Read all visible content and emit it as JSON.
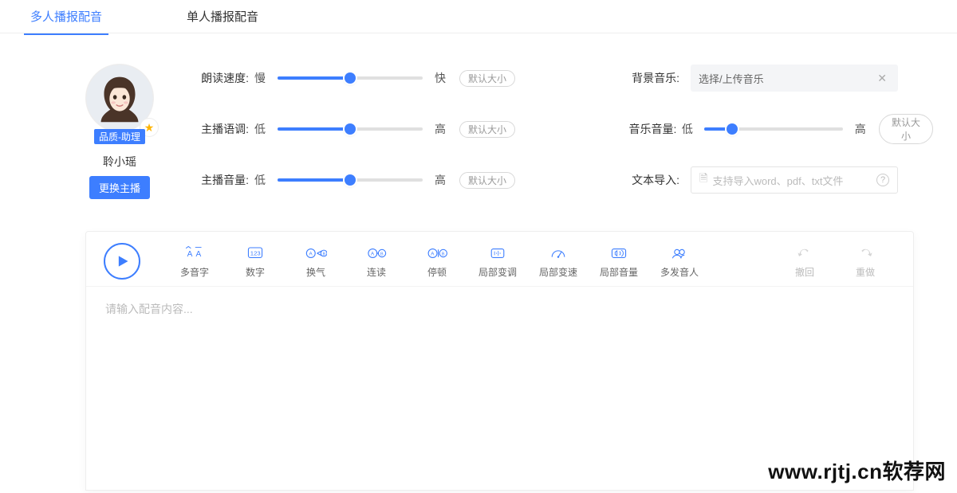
{
  "tabs": {
    "multi": "多人播报配音",
    "single": "单人播报配音"
  },
  "anchor": {
    "quality_tag": "品质-助理",
    "name": "聆小瑶",
    "swap_btn": "更换主播"
  },
  "sliders": {
    "default_size": "默认大小",
    "speed": {
      "label": "朗读速度:",
      "low": "慢",
      "high": "快",
      "pct": 50
    },
    "tone": {
      "label": "主播语调:",
      "low": "低",
      "high": "高",
      "pct": 50
    },
    "volume": {
      "label": "主播音量:",
      "low": "低",
      "high": "高",
      "pct": 50
    },
    "music_volume": {
      "label": "音乐音量:",
      "low": "低",
      "high": "高",
      "pct": 20
    }
  },
  "bgm": {
    "label": "背景音乐:",
    "placeholder": "选择/上传音乐"
  },
  "text_import": {
    "label": "文本导入:",
    "hint": "支持导入word、pdf、txt文件"
  },
  "toolbar": {
    "polyphonic": "多音字",
    "number": "数字",
    "breath": "换气",
    "liaison": "连读",
    "pause": "停顿",
    "local_pitch": "局部变调",
    "local_speed": "局部变速",
    "local_volume": "局部音量",
    "multi_speaker": "多发音人",
    "undo": "撤回",
    "redo": "重做"
  },
  "editor": {
    "placeholder": "请输入配音内容..."
  },
  "watermark": "www.rjtj.cn软荐网"
}
